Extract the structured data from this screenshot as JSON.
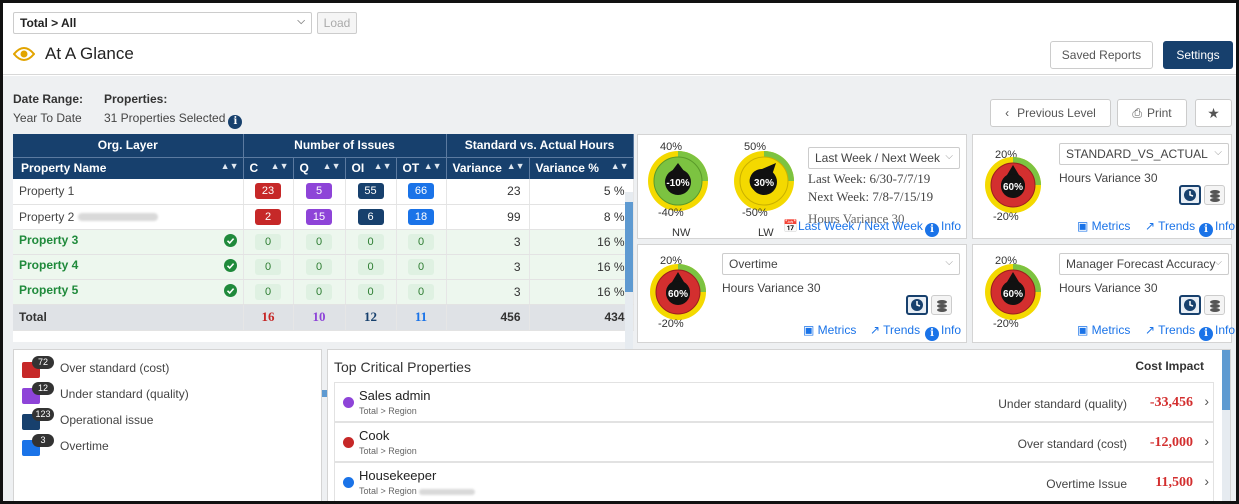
{
  "header": {
    "hierarchy_select": "Total > All",
    "load_label": "Load",
    "title": "At A Glance",
    "saved_reports_label": "Saved Reports",
    "settings_label": "Settings"
  },
  "filters": {
    "date_range_label": "Date Range:",
    "date_range_value": "Year To Date",
    "properties_label": "Properties:",
    "properties_value": "31 Properties Selected"
  },
  "toolbar": {
    "previous_level_label": "Previous Level",
    "print_label": "Print"
  },
  "table": {
    "group_headers": {
      "org_layer": "Org. Layer",
      "issues": "Number of Issues",
      "hours": "Standard vs. Actual Hours"
    },
    "columns": {
      "property_name": "Property Name",
      "c": "C",
      "q": "Q",
      "oi": "OI",
      "ot": "OT",
      "variance": "Variance",
      "variance_pct": "Variance %"
    },
    "rows": [
      {
        "name": "Property 1",
        "c": "23",
        "q": "5",
        "oi": "55",
        "ot": "66",
        "variance": "23",
        "variance_pct": "5 %"
      },
      {
        "name": "Property 2",
        "c": "2",
        "q": "15",
        "oi": "6",
        "ot": "18",
        "variance": "99",
        "variance_pct": "8 %"
      },
      {
        "name": "Property 3",
        "c": "0",
        "q": "0",
        "oi": "0",
        "ot": "0",
        "variance": "3",
        "variance_pct": "16 %"
      },
      {
        "name": "Property 4",
        "c": "0",
        "q": "0",
        "oi": "0",
        "ot": "0",
        "variance": "3",
        "variance_pct": "16 %"
      },
      {
        "name": "Property 5",
        "c": "0",
        "q": "0",
        "oi": "0",
        "ot": "0",
        "variance": "3",
        "variance_pct": "16 %"
      }
    ],
    "total": {
      "label": "Total",
      "c": "16",
      "q": "10",
      "oi": "12",
      "ot": "11",
      "variance": "456",
      "variance_pct": "434"
    }
  },
  "panels": {
    "p1": {
      "gauge_nw": {
        "value": "-10%",
        "top": "40%",
        "bottom": "-40%",
        "label": "NW"
      },
      "gauge_lw": {
        "value": "30%",
        "top": "50%",
        "bottom": "-50%",
        "label": "LW"
      },
      "dropdown": "Last Week / Next Week",
      "last_week": "Last Week: 6/30-7/7/19",
      "next_week": "Next Week: 7/8-7/15/19",
      "hours_variance": "Hours Variance 30",
      "link_lwnw": "Last Week / Next Week",
      "link_info": "Info"
    },
    "p2": {
      "gauge": {
        "value": "60%",
        "top": "20%",
        "bottom": "-20%"
      },
      "dropdown": "STANDARD_VS_ACTUAL",
      "hours_variance": "Hours Variance 30",
      "link_metrics": "Metrics",
      "link_trends": "Trends",
      "link_info": "Info"
    },
    "p3": {
      "gauge": {
        "value": "60%",
        "top": "20%",
        "bottom": "-20%"
      },
      "dropdown": "Overtime",
      "hours_variance": "Hours Variance 30",
      "link_metrics": "Metrics",
      "link_trends": "Trends",
      "link_info": "Info"
    },
    "p4": {
      "gauge": {
        "value": "60%",
        "top": "20%",
        "bottom": "-20%"
      },
      "dropdown": "Manager Forecast Accuracy",
      "hours_variance": "Hours Variance 30",
      "link_metrics": "Metrics",
      "link_trends": "Trends",
      "link_info": "Info"
    }
  },
  "legend": [
    {
      "count": "72",
      "label": "Over standard (cost)",
      "color": "#c62828"
    },
    {
      "count": "12",
      "label": "Under standard (quality)",
      "color": "#8e44d8"
    },
    {
      "count": "123",
      "label": "Operational issue",
      "color": "#17406d"
    },
    {
      "count": "3",
      "label": "Overtime",
      "color": "#1a73e8"
    }
  ],
  "critical": {
    "title": "Top Critical Properties",
    "cost_impact_label": "Cost Impact",
    "rows": [
      {
        "name": "Sales admin",
        "path": "Total > Region",
        "type": "Under standard (quality)",
        "value": "-33,456",
        "color": "#8e44d8"
      },
      {
        "name": "Cook",
        "path": "Total > Region",
        "type": "Over standard (cost)",
        "value": "-12,000",
        "color": "#c62828"
      },
      {
        "name": "Housekeeper",
        "path": "Total > Region",
        "type": "Overtime Issue",
        "value": "11,500",
        "color": "#1a73e8"
      }
    ]
  },
  "colors": {
    "primary": "#17406d",
    "link": "#1a73e8",
    "danger": "#d32f2f",
    "success": "#1f8a3b"
  }
}
